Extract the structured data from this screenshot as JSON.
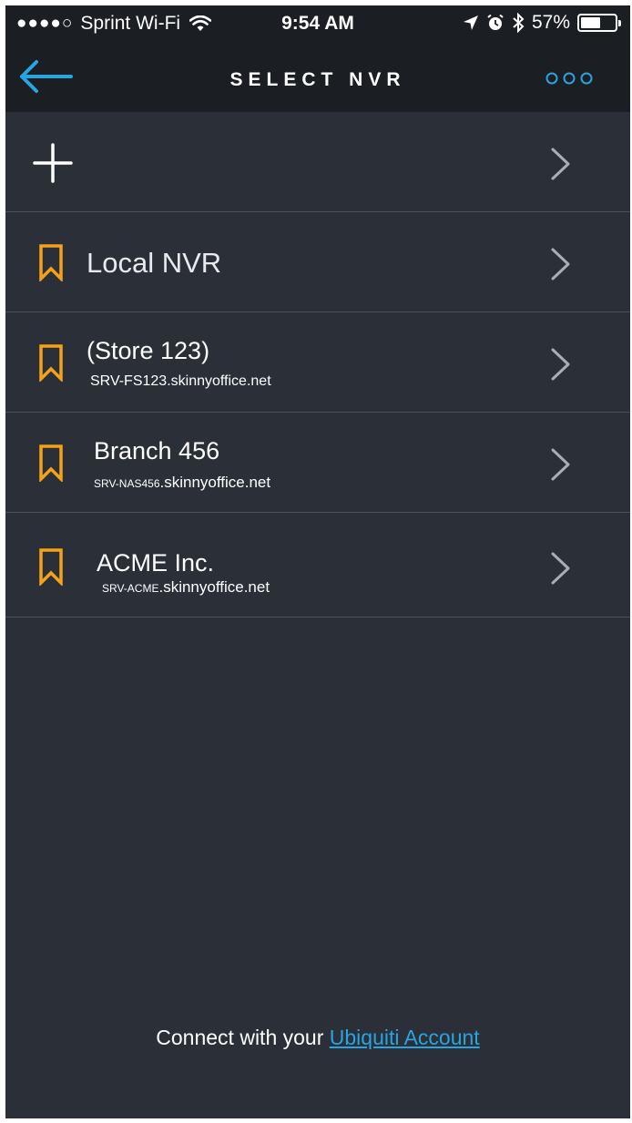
{
  "status_bar": {
    "signal": "●●●●○",
    "carrier": "Sprint Wi-Fi",
    "time": "9:54 AM",
    "battery": "57%",
    "battery_level": 0.57
  },
  "nav": {
    "title": "SELECT NVR"
  },
  "list": {
    "local": {
      "name": "Local NVR"
    },
    "store": {
      "name": "(Store 123)",
      "host_prefix": "SRV-FS123",
      "host_suffix": ".skinnyoffice.net"
    },
    "branch": {
      "name": "Branch 456",
      "host_prefix": "SRV-NAS456",
      "host_suffix": ".skinnyoffice.net"
    },
    "acme": {
      "name": "ACME Inc.",
      "host_prefix": "SRV-ACME",
      "host_suffix": ".skinnyoffice.net"
    }
  },
  "footer": {
    "text": "Connect with your ",
    "link": "Ubiquiti Account"
  },
  "colors": {
    "accent": "#2aa4e0",
    "bookmark": "#f5a21b",
    "background": "#2b2f38",
    "bar": "#1b1e23"
  },
  "icons": {
    "back": "arrow-left-icon",
    "more": "more-icon",
    "add": "plus-icon",
    "bookmark": "bookmark-icon",
    "chevron": "chevron-right-icon"
  }
}
